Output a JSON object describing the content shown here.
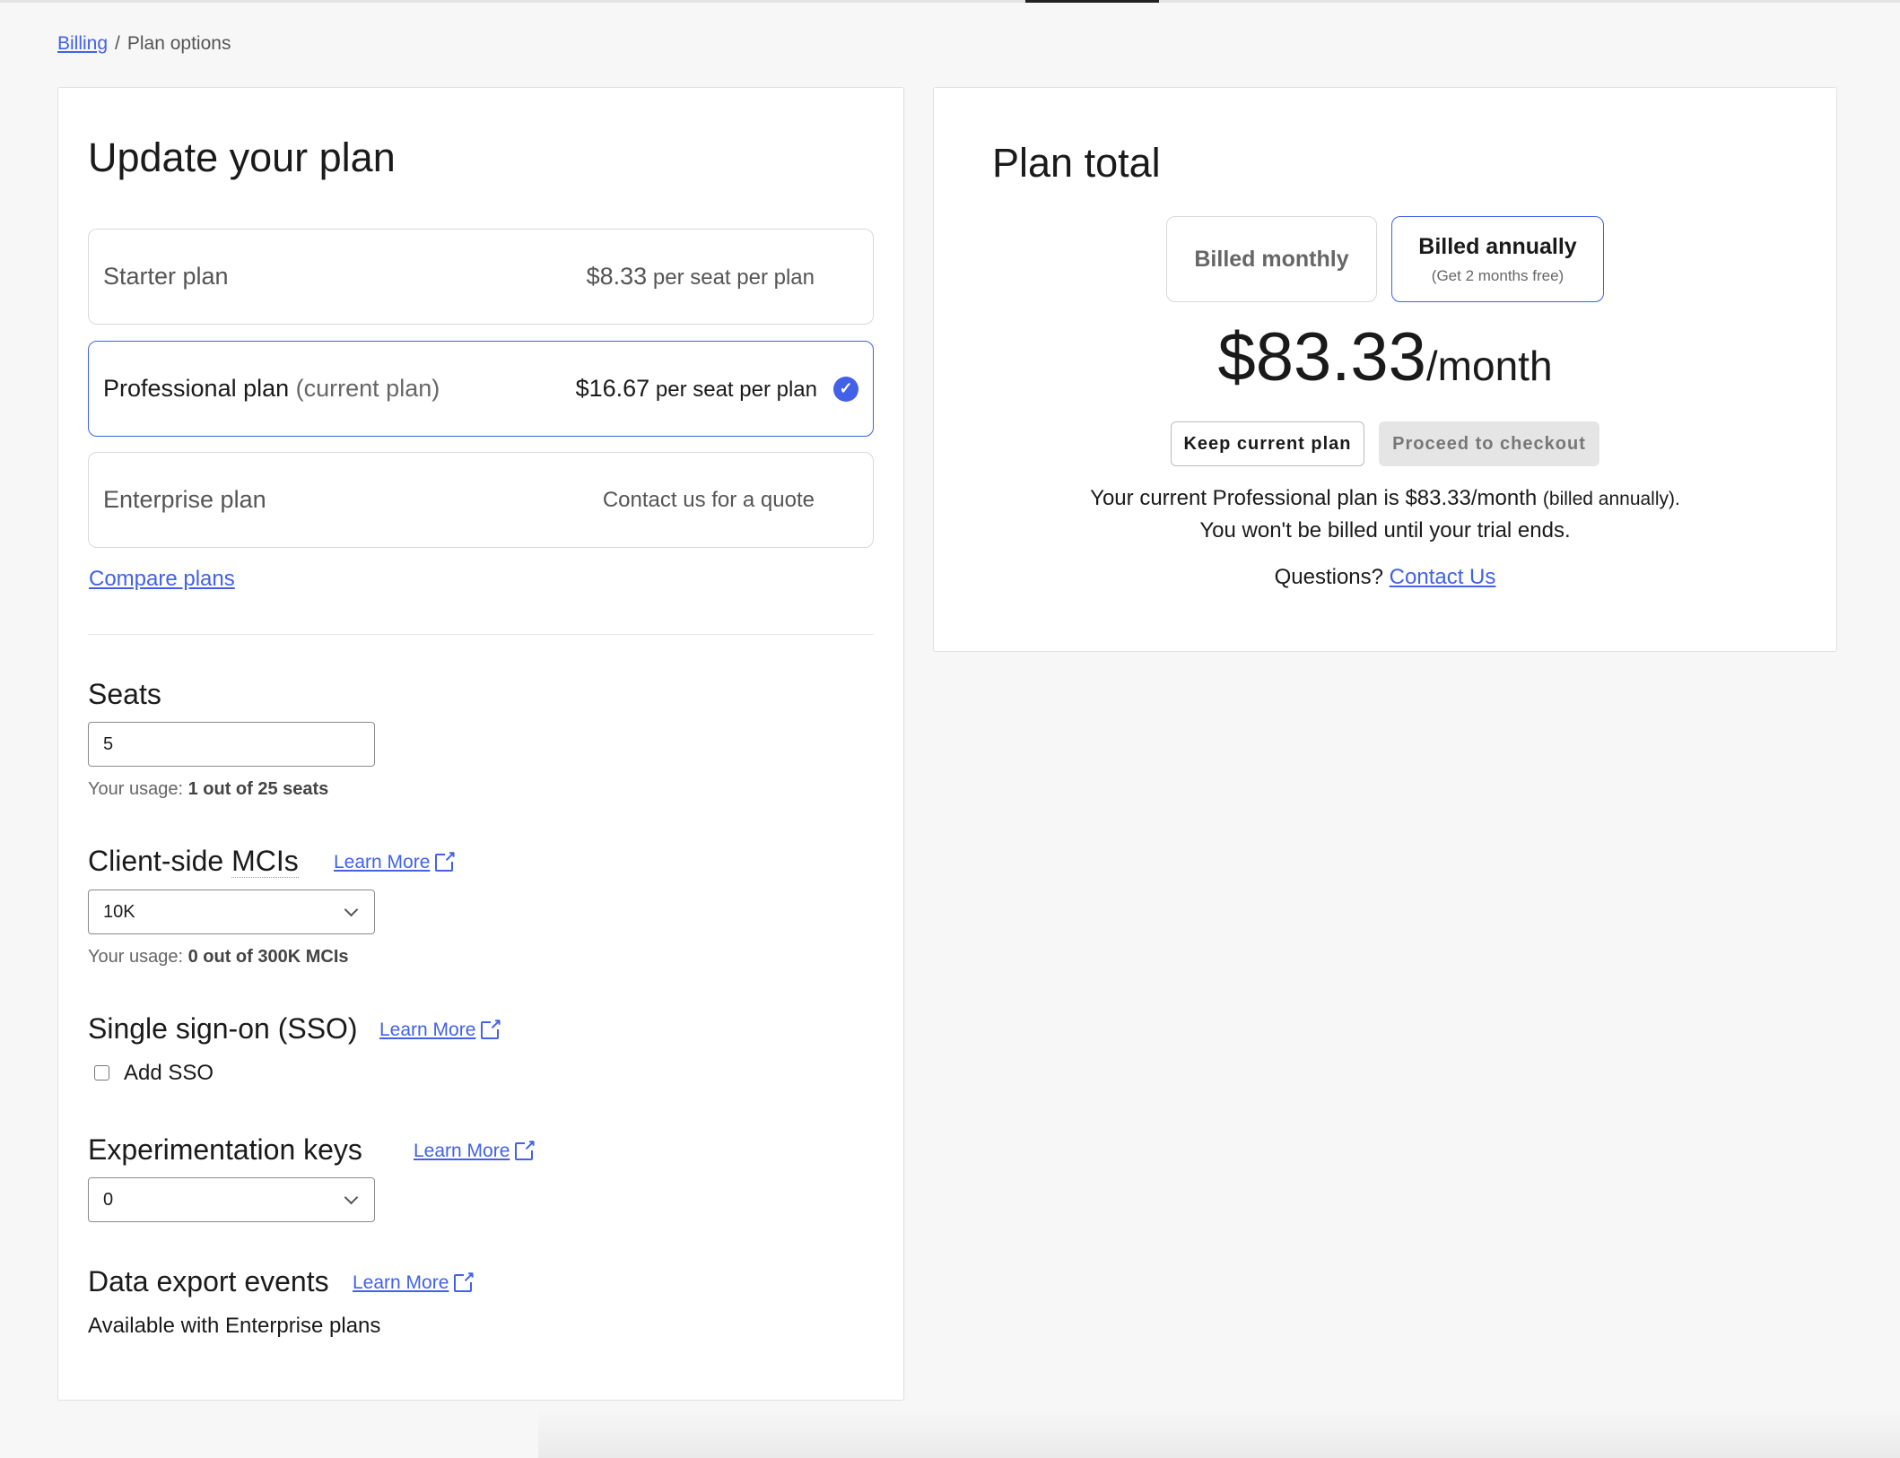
{
  "breadcrumb": {
    "parent": "Billing",
    "separator": "/",
    "current": "Plan options"
  },
  "left": {
    "title": "Update your plan",
    "plans": [
      {
        "name": "Starter plan",
        "price": "$8.33",
        "per": "per seat per plan",
        "selected": false
      },
      {
        "name": "Professional plan",
        "note": "(current plan)",
        "price": "$16.67",
        "per": "per seat per plan",
        "selected": true
      },
      {
        "name": "Enterprise plan",
        "price_text": "Contact us for a quote",
        "selected": false
      }
    ],
    "compare": "Compare plans",
    "seats": {
      "heading": "Seats",
      "value": "5",
      "usage_label": "Your usage:",
      "usage_value": "1 out of 25  seats"
    },
    "mcis": {
      "heading_a": "Client-side ",
      "heading_b": "MCIs",
      "learn": "Learn More",
      "value": "10K",
      "usage_label": "Your usage:",
      "usage_value": "0 out of 300K MCIs"
    },
    "sso": {
      "heading": "Single sign-on (SSO)",
      "learn": "Learn More",
      "checkbox_label": "Add SSO",
      "checked": false
    },
    "exp": {
      "heading": "Experimentation keys",
      "learn": "Learn More",
      "value": "0"
    },
    "export": {
      "heading": "Data export events",
      "learn": "Learn More",
      "text": "Available with Enterprise plans"
    }
  },
  "right": {
    "title": "Plan total",
    "monthly": "Billed monthly",
    "annually": "Billed annually",
    "annually_note": "(Get 2 months free)",
    "selected_billing": "annually",
    "price": "$83.33",
    "per": "/month",
    "keep": "Keep current plan",
    "proceed": "Proceed to checkout",
    "line1": "Your current Professional plan is $83.33/month",
    "line1_small": "(billed annually).",
    "line2": "You won't be billed until your trial ends.",
    "questions": "Questions?",
    "contact": "Contact Us"
  },
  "colors": {
    "accent": "#4261e8",
    "background": "#f7f7f7"
  }
}
